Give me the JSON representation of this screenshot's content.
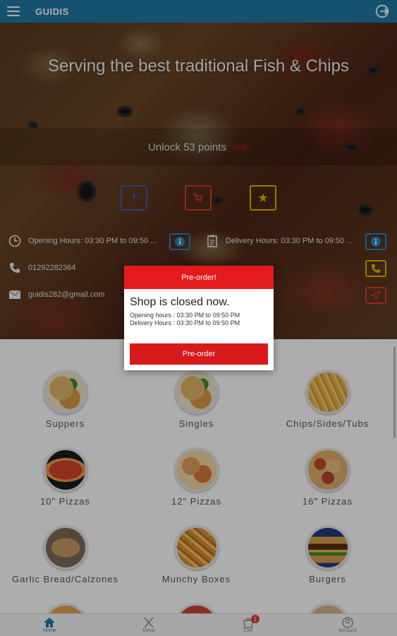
{
  "appbar": {
    "title": "GUIDIS",
    "menu_icon": "hamburger-menu-icon",
    "logout_icon": "logout-icon"
  },
  "hero": {
    "tagline": "Serving the best traditional Fish & Chips",
    "unlock_text": "Unlock 53 points",
    "social": {
      "facebook_glyph": "f",
      "cart_icon": "cart-icon",
      "star_glyph": "★"
    },
    "opening_hours": "Opening Hours: 03:30 PM to 09:50 ...",
    "delivery_hours": "Delivery Hours: 03:30 PM to 09:50 ...",
    "phone": "01292282364",
    "email": "guidis282@gmail.com"
  },
  "dialog": {
    "header": "Pre-order!",
    "message": "Shop is closed now.",
    "opening_line": "Opening hours : 03:30 PM to 09:50 PM",
    "delivery_line": "Delivery Hours : 03:30 PM to 09:50 PM",
    "button": "Pre-order"
  },
  "categories": [
    {
      "label": "Suppers",
      "icon": "fish-chips-photo"
    },
    {
      "label": "Singles",
      "icon": "fish-chips-photo"
    },
    {
      "label": "Chips/Sides/Tubs",
      "icon": "fries-photo"
    },
    {
      "label": "10\" Pizzas",
      "icon": "pizza-photo"
    },
    {
      "label": "12\" Pizzas",
      "icon": "pizza-photo"
    },
    {
      "label": "16\" Pizzas",
      "icon": "pizza-photo"
    },
    {
      "label": "Garlic Bread/Calzones",
      "icon": "calzone-photo"
    },
    {
      "label": "Munchy Boxes",
      "icon": "munchy-box-photo"
    },
    {
      "label": "Burgers",
      "icon": "burger-photo"
    }
  ],
  "bottomnav": [
    {
      "label": "Home",
      "icon": "home-icon",
      "active": true
    },
    {
      "label": "Menu",
      "icon": "fork-knife-icon"
    },
    {
      "label": "Cart",
      "icon": "cart-icon",
      "badge": "1"
    },
    {
      "label": "Account",
      "icon": "account-icon"
    }
  ],
  "colors": {
    "appbar": "#1f7aa6",
    "dialog_red": "#e31b1b",
    "facebook": "#3d5ab0",
    "cart": "#d83a2a",
    "star": "#e2b400",
    "info_blue": "#1f86c8"
  }
}
